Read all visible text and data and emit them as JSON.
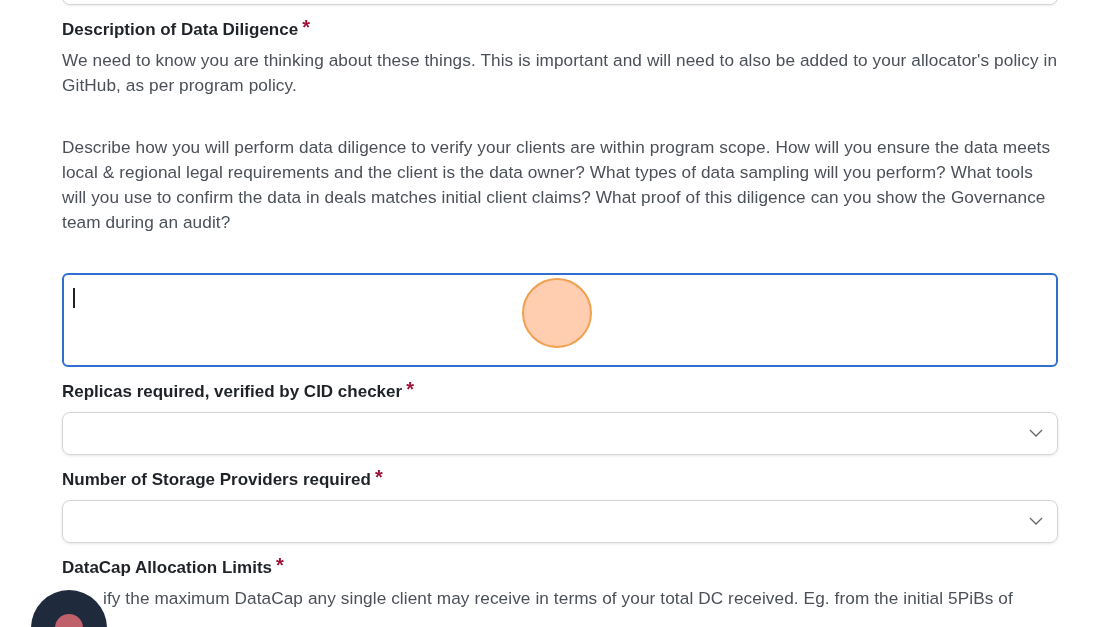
{
  "sections": [
    {
      "kind": "textarea",
      "label": "Description of Data Diligence",
      "required": true,
      "paragraphs": [
        "We need to know you are thinking about these things. This is important and will need to also be added to your allocator's policy in GitHub, as per program policy.",
        "Describe how you will perform data diligence to verify your clients are within program scope. How will you ensure the data meets local & regional legal requirements and the client is the data owner? What types of data sampling will you perform? What tools will you use to confirm the data in deals matches initial client claims? What proof of this diligence can you show the Governance team during an audit?"
      ],
      "focused": true
    },
    {
      "kind": "select",
      "label": "Replicas required, verified by CID checker",
      "required": true
    },
    {
      "kind": "select",
      "label": "Number of Storage Providers required",
      "required": true
    },
    {
      "kind": "partial",
      "label": "DataCap Allocation Limits",
      "required": true,
      "paragraphs": [
        "ify the maximum DataCap any single client may receive in terms of your total DC received. Eg. from the initial 5PiBs of"
      ]
    }
  ],
  "required_mark": "*"
}
